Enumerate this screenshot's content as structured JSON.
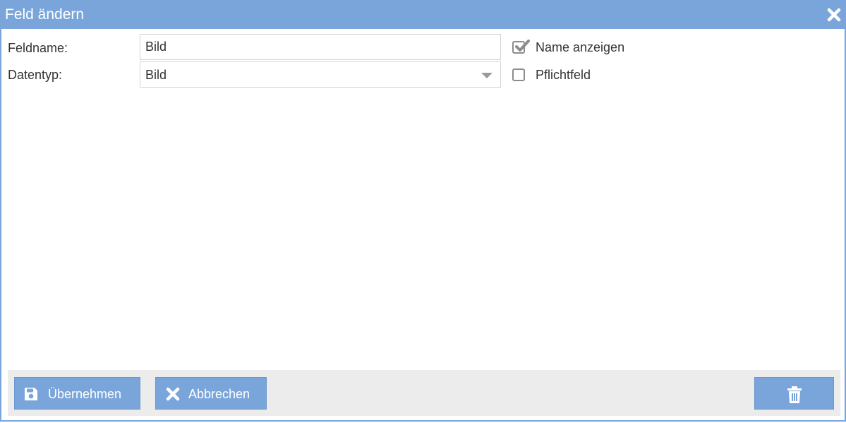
{
  "dialog": {
    "title": "Feld ändern",
    "close_icon": "close-icon"
  },
  "form": {
    "fieldname_label": "Feldname:",
    "fieldname_value": "Bild",
    "datatype_label": "Datentyp:",
    "datatype_value": "Bild"
  },
  "options": {
    "show_name_label": "Name anzeigen",
    "show_name_checked": true,
    "required_label": "Pflichtfeld",
    "required_checked": false
  },
  "footer": {
    "apply_label": "Übernehmen",
    "apply_icon": "floppy-disk-icon",
    "cancel_label": "Abbrechen",
    "cancel_icon": "x-icon",
    "delete_icon": "trash-icon"
  },
  "colors": {
    "accent": "#7aa5da",
    "footer_bg": "#ececec"
  }
}
